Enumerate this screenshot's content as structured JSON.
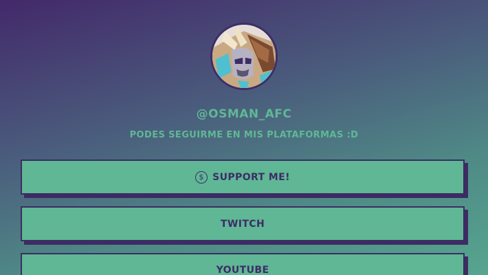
{
  "profile": {
    "handle": "@osman_afc",
    "subtitle": "Podes seguirme en mis plataformas :D",
    "avatar_icon": "avatar-portrait"
  },
  "links": [
    {
      "label": "Support me!",
      "icon": "dollar-coin-icon"
    },
    {
      "label": "Twitch"
    },
    {
      "label": "YouTube"
    }
  ],
  "colors": {
    "accent": "#5fb795",
    "border": "#3c2c63",
    "bg_top": "#43296a",
    "bg_bottom": "#57a58f"
  }
}
